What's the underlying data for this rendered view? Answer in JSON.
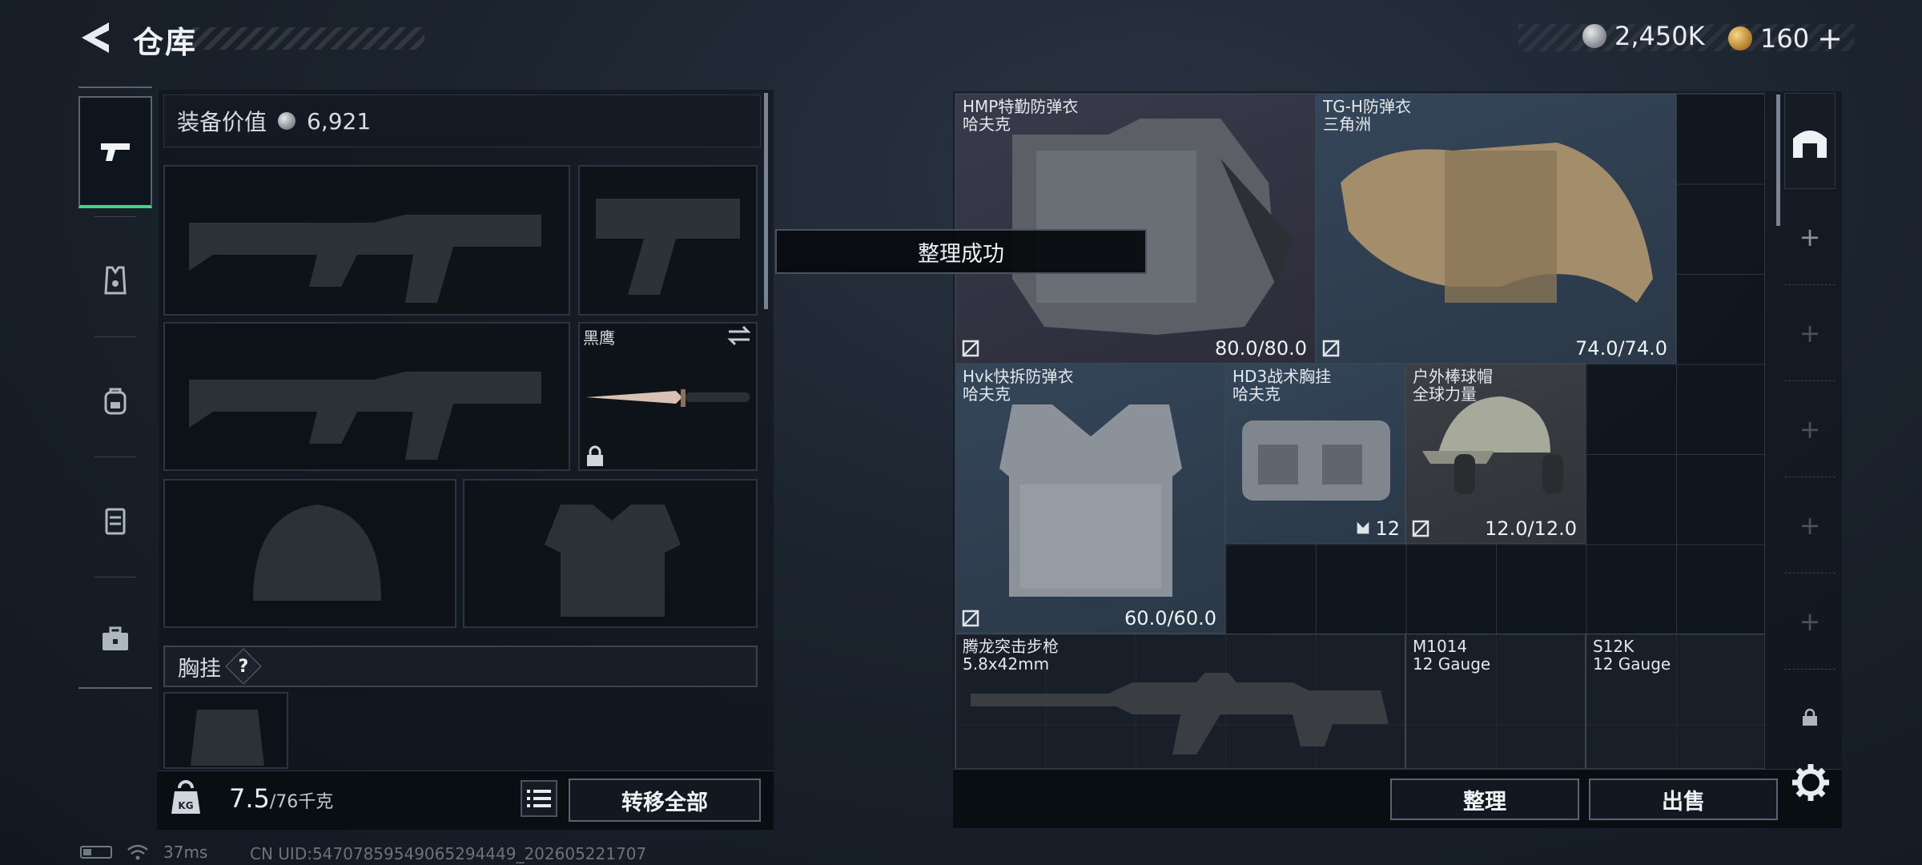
{
  "header": {
    "title": "仓库",
    "currency_silver": "2,450K",
    "currency_gold": "160",
    "add_label": "+"
  },
  "loadout": {
    "value_label": "装备价值",
    "value": "6,921",
    "melee_name": "黑鹰",
    "vest_label": "胸挂",
    "help_label": "?",
    "weight_current": "7.5",
    "weight_max": "/76千克",
    "transfer_all_label": "转移全部"
  },
  "toast": "整理成功",
  "inventory": [
    {
      "name": "HMP特勤防弹衣",
      "sub": "哈夫克",
      "durability": "80.0/80.0"
    },
    {
      "name": "TG-H防弹衣",
      "sub": "三角洲",
      "durability": "74.0/74.0"
    },
    {
      "name": "Hvk快拆防弹衣",
      "sub": "哈夫克",
      "durability": "60.0/60.0"
    },
    {
      "name": "HD3战术胸挂",
      "sub": "哈夫克",
      "count": "12"
    },
    {
      "name": "户外棒球帽",
      "sub": "全球力量",
      "durability": "12.0/12.0"
    },
    {
      "name": "腾龙突击步枪",
      "sub": "5.8x42mm"
    },
    {
      "name": "M1014",
      "sub": "12 Gauge"
    },
    {
      "name": "S12K",
      "sub": "12 Gauge"
    }
  ],
  "actions": {
    "sort_label": "整理",
    "sell_label": "出售"
  },
  "side_slots": [
    "+",
    "+",
    "+",
    "+",
    "+"
  ],
  "status": {
    "ping": "37ms",
    "uid": "CN UID:5470785954906529444​9_202605221707"
  },
  "colors": {
    "accent_green": "#3ed58a",
    "rarity_purple": "#3b3a4c",
    "rarity_blue": "#35465a"
  }
}
